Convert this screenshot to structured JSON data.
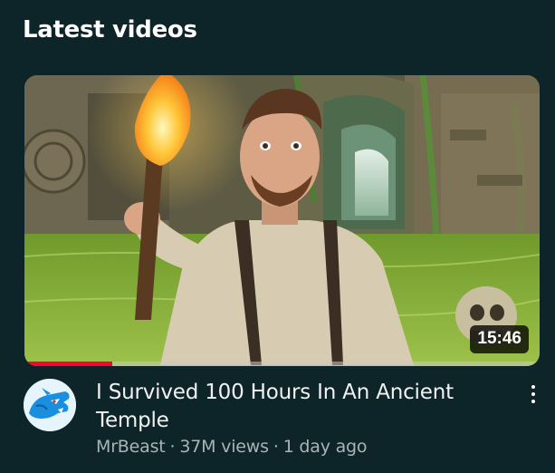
{
  "section": {
    "title": "Latest videos"
  },
  "video": {
    "title": "I Survived 100 Hours In An Ancient Temple",
    "duration": "15:46",
    "channel": "MrBeast",
    "views": "37M views",
    "age": "1 day ago",
    "separator": "·",
    "watch_progress_percent": 17,
    "thumbnail_icon": "jungle-temple-thumbnail",
    "avatar_icon": "mrbeast-panther-logo-icon",
    "more_icon": "more-vertical-icon"
  },
  "colors": {
    "background": "#0d2428",
    "progress": "#ff0033",
    "meta_text": "#aab4b6"
  }
}
